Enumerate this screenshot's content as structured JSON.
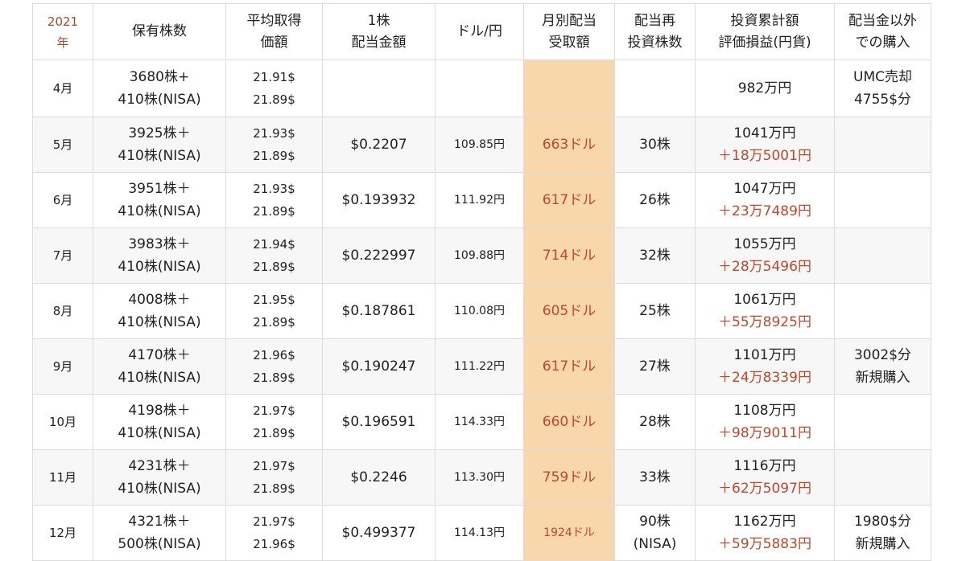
{
  "headers": {
    "year": "2021",
    "year_suffix": "年",
    "holdings": "保有株数",
    "avg_price_1": "平均取得",
    "avg_price_2": "価額",
    "div_per_share_1": "1株",
    "div_per_share_2": "配当金額",
    "fx": "ドル/円",
    "monthly_div_1": "月別配当",
    "monthly_div_2": "受取額",
    "reinvest_1": "配当再",
    "reinvest_2": "投資株数",
    "total_1": "投資累計額",
    "total_2": "評価損益(円貨)",
    "other_1": "配当金以外",
    "other_2": "での購入"
  },
  "rows": [
    {
      "month": "4月",
      "hold1": "3680株+",
      "hold2": "410株(NISA)",
      "price1": "21.91$",
      "price2": "21.89$",
      "div": "",
      "fx": "",
      "recv": "",
      "reinv1": "",
      "reinv2": "",
      "total": "982万円",
      "pl": "",
      "other1": "UMC売却",
      "other2": "4755$分"
    },
    {
      "month": "5月",
      "hold1": "3925株＋",
      "hold2": "410株(NISA)",
      "price1": "21.93$",
      "price2": "21.89$",
      "div": "$0.2207",
      "fx": "109.85円",
      "recv": "663ドル",
      "reinv1": "30株",
      "reinv2": "",
      "total": "1041万円",
      "pl": "＋18万5001円",
      "other1": "",
      "other2": ""
    },
    {
      "month": "6月",
      "hold1": "3951株＋",
      "hold2": "410株(NISA)",
      "price1": "21.93$",
      "price2": "21.89$",
      "div": "$0.193932",
      "fx": "111.92円",
      "recv": "617ドル",
      "reinv1": "26株",
      "reinv2": "",
      "total": "1047万円",
      "pl": "＋23万7489円",
      "other1": "",
      "other2": ""
    },
    {
      "month": "7月",
      "hold1": "3983株＋",
      "hold2": "410株(NISA)",
      "price1": "21.94$",
      "price2": "21.89$",
      "div": "$0.222997",
      "fx": "109.88円",
      "recv": "714ドル",
      "reinv1": "32株",
      "reinv2": "",
      "total": "1055万円",
      "pl": "＋28万5496円",
      "other1": "",
      "other2": ""
    },
    {
      "month": "8月",
      "hold1": "4008株＋",
      "hold2": "410株(NISA)",
      "price1": "21.95$",
      "price2": "21.89$",
      "div": "$0.187861",
      "fx": "110.08円",
      "recv": "605ドル",
      "reinv1": "25株",
      "reinv2": "",
      "total": "1061万円",
      "pl": "＋55万8925円",
      "other1": "",
      "other2": ""
    },
    {
      "month": "9月",
      "hold1": "4170株＋",
      "hold2": "410株(NISA)",
      "price1": "21.96$",
      "price2": "21.89$",
      "div": "$0.190247",
      "fx": "111.22円",
      "recv": "617ドル",
      "reinv1": "27株",
      "reinv2": "",
      "total": "1101万円",
      "pl": "＋24万8339円",
      "other1": "3002$分",
      "other2": "新規購入"
    },
    {
      "month": "10月",
      "hold1": "4198株＋",
      "hold2": "410株(NISA)",
      "price1": "21.97$",
      "price2": "21.89$",
      "div": "$0.196591",
      "fx": "114.33円",
      "recv": "660ドル",
      "reinv1": "28株",
      "reinv2": "",
      "total": "1108万円",
      "pl": "＋98万9011円",
      "other1": "",
      "other2": ""
    },
    {
      "month": "11月",
      "hold1": "4231株＋",
      "hold2": "410株(NISA)",
      "price1": "21.97$",
      "price2": "21.89$",
      "div": "$0.2246",
      "fx": "113.30円",
      "recv": "759ドル",
      "reinv1": "33株",
      "reinv2": "",
      "total": "1116万円",
      "pl": "＋62万5097円",
      "other1": "",
      "other2": ""
    },
    {
      "month": "12月",
      "hold1": "4321株＋",
      "hold2": "500株(NISA)",
      "price1": "21.97$",
      "price2": "21.96$",
      "div": "$0.499377",
      "fx": "114.13円",
      "recv": "1924ドル",
      "reinv1": "90株",
      "reinv2": "(NISA)",
      "total": "1162万円",
      "pl": "＋59万5883円",
      "other1": "1980$分",
      "other2": "新規購入"
    }
  ]
}
